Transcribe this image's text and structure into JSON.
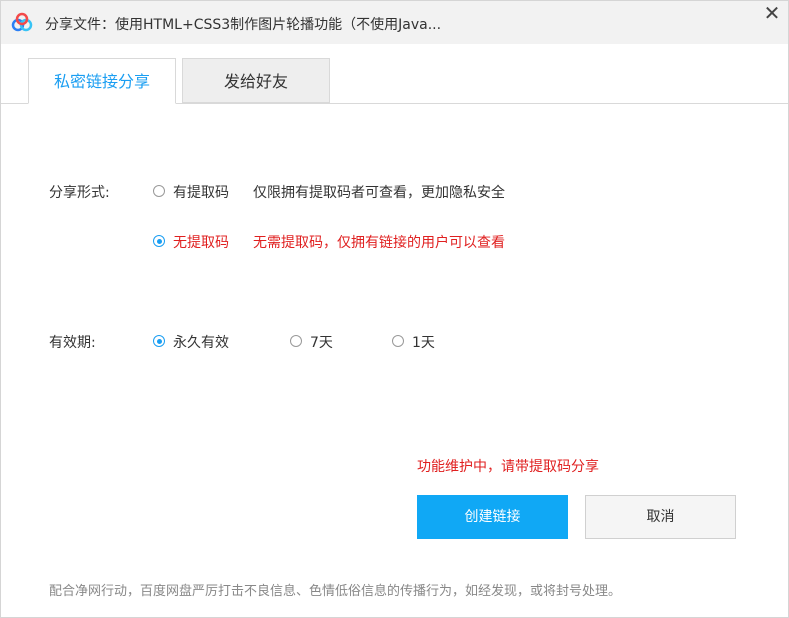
{
  "window": {
    "title": "分享文件：使用HTML+CSS3制作图片轮播功能（不使用Java...",
    "close_glyph": "✕",
    "app_icon": "baidu-netdisk-icon"
  },
  "tabs": [
    {
      "label": "私密链接分享",
      "active": true
    },
    {
      "label": "发给好友",
      "active": false
    }
  ],
  "share_form": {
    "label": "分享形式:",
    "options": [
      {
        "label": "有提取码",
        "description": "仅限拥有提取码者可查看，更加隐私安全",
        "selected": false
      },
      {
        "label": "无提取码",
        "description": "无需提取码，仅拥有链接的用户可以查看",
        "selected": true
      }
    ]
  },
  "validity": {
    "label": "有效期:",
    "options": [
      {
        "label": "永久有效",
        "selected": true
      },
      {
        "label": "7天",
        "selected": false
      },
      {
        "label": "1天",
        "selected": false
      }
    ]
  },
  "warning": "功能维护中，请带提取码分享",
  "buttons": {
    "create": "创建链接",
    "cancel": "取消"
  },
  "footer_notice": "配合净网行动，百度网盘严厉打击不良信息、色情低俗信息的传播行为，如经发现，或将封号处理。",
  "colors": {
    "accent": "#1a9ef2",
    "primary_button": "#10a8f5",
    "warning": "#e02020"
  }
}
